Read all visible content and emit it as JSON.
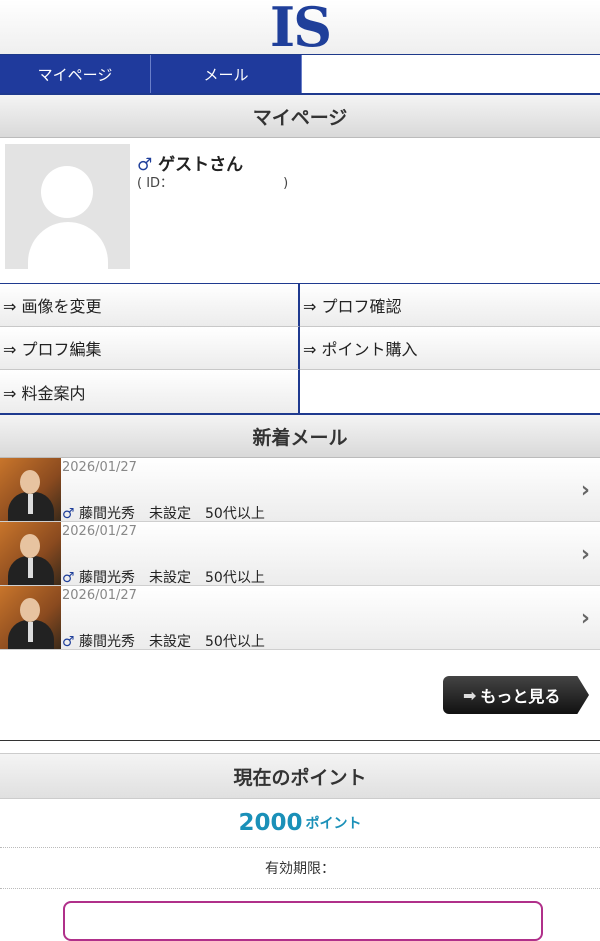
{
  "logo": "IS",
  "nav": {
    "tabs": [
      {
        "label": "マイページ"
      },
      {
        "label": "メール"
      }
    ]
  },
  "mypage": {
    "heading": "マイページ",
    "gender_symbol": "♂",
    "user_name": "ゲストさん",
    "id_prefix": "( ID：",
    "id_value": "",
    "id_suffix": ")"
  },
  "menu": [
    {
      "label": "⇒ 画像を変更"
    },
    {
      "label": "⇒ プロフ確認"
    },
    {
      "label": "⇒ プロフ編集"
    },
    {
      "label": "⇒ ポイント購入"
    },
    {
      "label": "⇒ 料金案内"
    }
  ],
  "mail": {
    "heading": "新着メール",
    "items": [
      {
        "date": "2026/01/27",
        "gender": "♂",
        "name": "藤間光秀",
        "region": "未設定",
        "age": "50代以上"
      },
      {
        "date": "2026/01/27",
        "gender": "♂",
        "name": "藤間光秀",
        "region": "未設定",
        "age": "50代以上"
      },
      {
        "date": "2026/01/27",
        "gender": "♂",
        "name": "藤間光秀",
        "region": "未設定",
        "age": "50代以上"
      }
    ],
    "more_label": "もっと見る"
  },
  "points": {
    "heading": "現在のポイント",
    "value": "2000",
    "unit": "ポイント",
    "expiry_label": "有効期限："
  },
  "colors": {
    "nav": "#1f3a9c",
    "accent": "#1a90b8",
    "buy": "#b0308a"
  }
}
